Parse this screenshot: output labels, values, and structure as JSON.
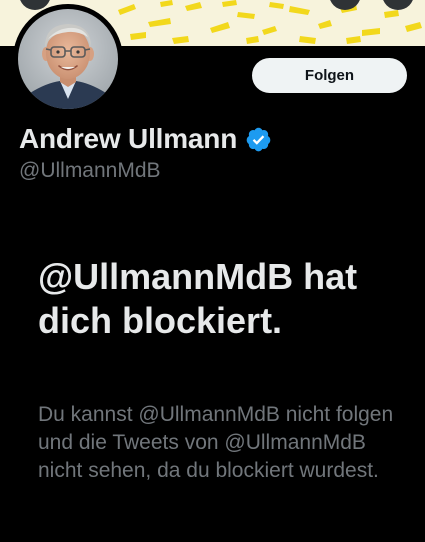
{
  "profile": {
    "display_name": "Andrew Ullmann",
    "handle": "@UllmannMdB",
    "verified": true,
    "verified_icon": "verified-badge-icon",
    "avatar": "profile-photo"
  },
  "header": {
    "follow_label": "Folgen"
  },
  "blocked_notice": {
    "headline": "@UllmannMdB hat dich blockiert.",
    "message": "Du kannst @UllmannMdB nicht folgen und die Tweets von @UllmannMdB nicht sehen, da du blockiert wurdest."
  },
  "colors": {
    "background": "#000000",
    "primary_text": "#e7e9ea",
    "secondary_text": "#71767b",
    "verified_blue": "#1d9bf0",
    "follow_button_bg": "#eff3f4",
    "banner_bg": "#f7f3dc",
    "banner_accent": "#f2d81c"
  }
}
